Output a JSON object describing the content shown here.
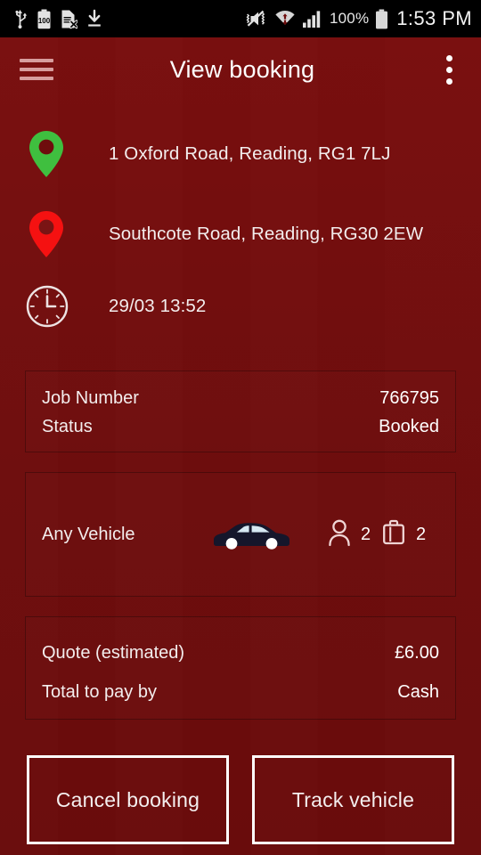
{
  "theme": {
    "background": "#6E0D0D",
    "statusbar_background": "#000000",
    "text_primary": "#F3EDED",
    "accent_menu": "#D79E9E",
    "pickup_pin": "#3FBF3F",
    "dropoff_pin": "#F51111",
    "button_border": "#FFFFFF",
    "car_body": "#1A1A2E"
  },
  "statusbar": {
    "left_icons": [
      {
        "name": "usb-icon",
        "label": "USB"
      },
      {
        "name": "battery-saver-icon",
        "label": "100"
      },
      {
        "name": "sim-card-error-icon",
        "label": "No SIM"
      },
      {
        "name": "download-icon",
        "label": "Download"
      }
    ],
    "right_icons": [
      {
        "name": "mute-vibrate-icon",
        "label": "Silent"
      },
      {
        "name": "wifi-icon",
        "label": "Wi-Fi"
      },
      {
        "name": "cellular-signal-icon",
        "label": "Signal"
      }
    ],
    "battery_percent": "100%",
    "battery_icon": "battery-full-icon",
    "clock": "1:53 PM"
  },
  "header": {
    "menu_icon": "hamburger-menu-icon",
    "title": "View booking",
    "overflow_icon": "overflow-menu-icon"
  },
  "trip": {
    "pickup": {
      "icon": "map-pin-pickup-icon",
      "address": "1 Oxford Road, Reading, RG1 7LJ"
    },
    "dropoff": {
      "icon": "map-pin-dropoff-icon",
      "address": "Southcote Road, Reading, RG30 2EW"
    },
    "schedule": {
      "icon": "clock-icon",
      "datetime": "29/03 13:52"
    }
  },
  "job_card": {
    "rows": [
      {
        "label": "Job Number",
        "value": "766795"
      },
      {
        "label": "Status",
        "value": "Booked"
      }
    ]
  },
  "vehicle_card": {
    "name": "Any Vehicle",
    "vehicle_icon": "car-sedan-icon",
    "passengers": {
      "icon": "person-icon",
      "count": "2"
    },
    "luggage": {
      "icon": "suitcase-icon",
      "count": "2"
    }
  },
  "fare_card": {
    "rows": [
      {
        "label": "Quote (estimated)",
        "value": "£6.00"
      },
      {
        "label": "Total to pay by",
        "value": "Cash"
      }
    ]
  },
  "actions": {
    "cancel_label": "Cancel booking",
    "track_label": "Track vehicle"
  }
}
